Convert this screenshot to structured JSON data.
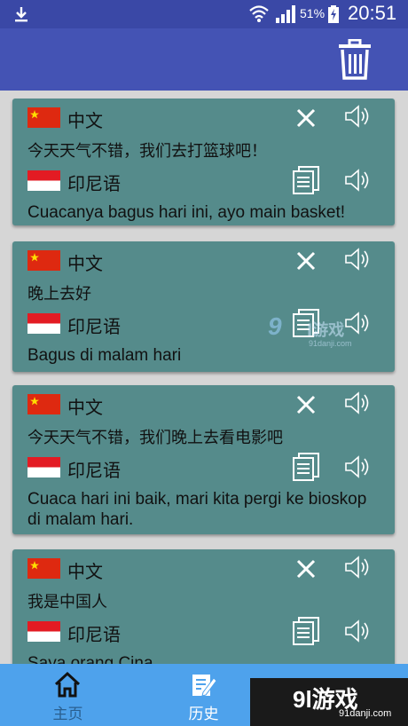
{
  "status_bar": {
    "battery": "51%",
    "time": "20:51"
  },
  "app_bar": {
    "delete_icon": "trash-icon"
  },
  "cards": [
    {
      "src_lang": "中文",
      "src_text": "今天天气不错，我们去打篮球吧！",
      "dst_lang": "印尼语",
      "dst_text": "Cuacanya bagus hari ini, ayo main basket!"
    },
    {
      "src_lang": "中文",
      "src_text": "晚上去好",
      "dst_lang": "印尼语",
      "dst_text": "Bagus di malam hari"
    },
    {
      "src_lang": "中文",
      "src_text": "今天天气不错，我们晚上去看电影吧",
      "dst_lang": "印尼语",
      "dst_text": "Cuaca hari ini baik, mari kita pergi ke bioskop di malam hari."
    },
    {
      "src_lang": "中文",
      "src_text": "我是中国人",
      "dst_lang": "印尼语",
      "dst_text": "Saya orang Cina"
    }
  ],
  "bottom_nav": [
    {
      "label": "主页",
      "icon": "home-icon"
    },
    {
      "label": "历史",
      "icon": "history-icon"
    }
  ],
  "watermark": {
    "logo": "9l游戏",
    "url": "91danji.com"
  },
  "colors": {
    "status_bar": "#3a48a6",
    "app_bar": "#4453b4",
    "card": "#558b8b",
    "bottom_nav": "#4ea2ec",
    "background": "#d6d6d6"
  }
}
